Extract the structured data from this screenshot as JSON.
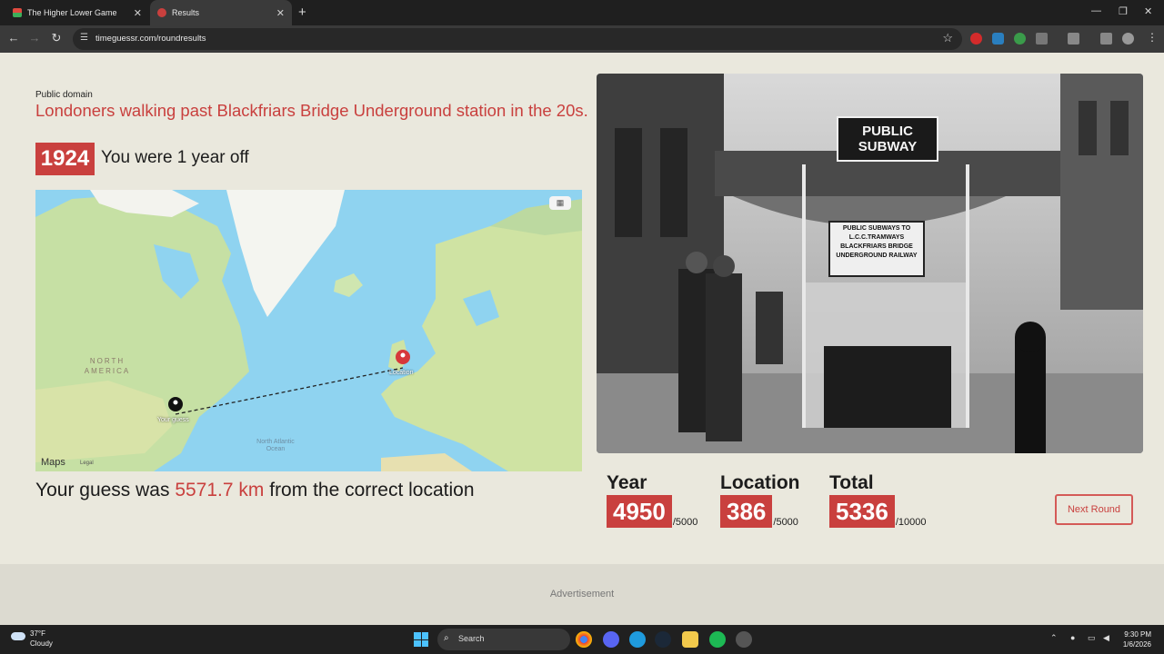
{
  "browser": {
    "tabs": [
      {
        "title": "The Higher Lower Game"
      },
      {
        "title": "Results"
      }
    ],
    "url": "timeguessr.com/roundresults"
  },
  "round": {
    "attribution": "Public domain",
    "description": "Londoners walking past Blackfriars Bridge Underground station in the 20s.",
    "actual_year": "1924",
    "year_feedback": "You were 1 year off",
    "distance_prefix": "Your guess was",
    "distance_value": "5571.7 km",
    "distance_suffix": "from the correct location"
  },
  "map": {
    "region_label": "NORTH AMERICA",
    "ocean_label": "North Atlantic Ocean",
    "guess_pin_label": "Your guess",
    "location_pin_label": "Location",
    "brand": "Maps",
    "legal": "Legal"
  },
  "photo": {
    "sign_top": "PUBLIC SUBWAY",
    "sign_lower": "PUBLIC SUBWAYS TO L.C.C.TRAMWAYS BLACKFRIARS BRIDGE UNDERGROUND RAILWAY"
  },
  "scores": {
    "year_label": "Year",
    "year_value": "4950",
    "year_max": "/5000",
    "location_label": "Location",
    "location_value": "386",
    "location_max": "/5000",
    "total_label": "Total",
    "total_value": "5336",
    "total_max": "/10000"
  },
  "next_button": "Next Round",
  "advertisement": "Advertisement",
  "taskbar": {
    "temp": "37°F",
    "condition": "Cloudy",
    "search_placeholder": "Search",
    "time": "9:30 PM",
    "date": "1/6/2026"
  },
  "colors": {
    "accent": "#c9403e",
    "page_bg": "#eae8dd"
  }
}
